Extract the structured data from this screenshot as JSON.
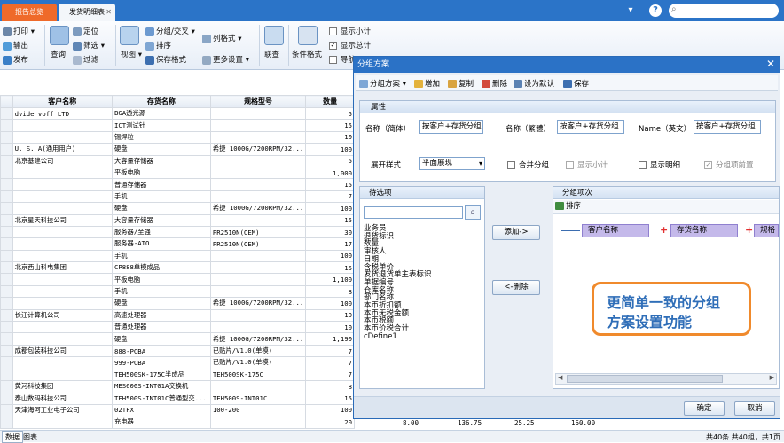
{
  "tabs": [
    {
      "label": "报告总览",
      "active": false
    },
    {
      "label": "发货明细表",
      "active": true
    }
  ],
  "ribbon": {
    "print": "打印",
    "export": "输出",
    "publish": "发布",
    "query": "查询",
    "locate": "定位",
    "filter": "筛选",
    "filter2": "过滤",
    "view": "视图",
    "group_cross": "分组/交叉",
    "sort": "排序",
    "save_format": "保存格式",
    "column_format": "列格式",
    "more_settings": "更多设置",
    "join_query": "联查",
    "condition_format": "条件格式",
    "show_subtotal": "显示小计",
    "show_total": "显示总计",
    "navigation": "导航"
  },
  "table": {
    "headers": [
      "客户名称",
      "存货名称",
      "规格型号",
      "数量"
    ],
    "rows": [
      [
        "dvide voff LTD",
        "BGA透光源",
        "",
        "5"
      ],
      [
        "",
        "ICT测试针",
        "",
        "15"
      ],
      [
        "",
        "锡焊粒",
        "",
        "10"
      ],
      [
        "U. S. A(通用用户)",
        "硬盘",
        "希捷 1000G/7200RPM/32...",
        "100"
      ],
      [
        "北京基建公司",
        "大容量存储器",
        "",
        "5"
      ],
      [
        "",
        "平板电脑",
        "",
        "1,000"
      ],
      [
        "",
        "普通存储器",
        "",
        "15"
      ],
      [
        "",
        "手机",
        "",
        "7"
      ],
      [
        "",
        "硬盘",
        "希捷 1000G/7200RPM/32...",
        "100"
      ],
      [
        "北京星天科技公司",
        "大容量存储器",
        "",
        "15"
      ],
      [
        "",
        "服务器/至强",
        "PR2510N(OEM)",
        "30"
      ],
      [
        "",
        "服务器-ATO",
        "PR2510N(OEM)",
        "17"
      ],
      [
        "",
        "手机",
        "",
        "100"
      ],
      [
        "北京西山科电集团",
        "CP888单模成品",
        "",
        "15"
      ],
      [
        "",
        "平板电脑",
        "",
        "1,100"
      ],
      [
        "",
        "手机",
        "",
        "8"
      ],
      [
        "",
        "硬盘",
        "希捷 1000G/7200RPM/32...",
        "100"
      ],
      [
        "长江计算机公司",
        "高速处理器",
        "",
        "10"
      ],
      [
        "",
        "普通处理器",
        "",
        "10"
      ],
      [
        "",
        "硬盘",
        "希捷 1000G/7200RPM/32...",
        "1,190"
      ],
      [
        "成都包装科技公司",
        "888-PCBA",
        "已贴片/V1.0(单模)",
        "7"
      ],
      [
        "",
        "999-PCBA",
        "已贴片/V1.0(单模)",
        "7"
      ],
      [
        "",
        "TEH500SK-175C半成品",
        "TEH500SK-175C",
        "7"
      ],
      [
        "黄河科技集团",
        "MES600S-INT01A交换机",
        "",
        "8"
      ],
      [
        "泰山数码科技公司",
        "TEH500S-INT01C普通型交...",
        "TEH500S-INT01C",
        "15"
      ],
      [
        "天津海河工业电子公司",
        "02TFX",
        "100-200",
        "100"
      ],
      [
        "",
        "充电器",
        "",
        "20"
      ]
    ]
  },
  "status": {
    "tab_data": "数据",
    "tab_chart": "图表",
    "summary": "共40条 共40组，共1页"
  },
  "underrow": {
    "v1": "8.00",
    "v2": "136.75",
    "v3": "25.25",
    "v4": "160.00"
  },
  "dialog": {
    "title": "分组方案",
    "toolbar": {
      "scheme": "分组方案",
      "add": "增加",
      "copy": "复制",
      "delete": "删除",
      "set_default": "设为默认",
      "save": "保存"
    },
    "attr_header": "属性",
    "name_cn_label": "名称（简体）",
    "name_cn_value": "按客户+存货分组",
    "name_tw_label": "名称（繁體）",
    "name_tw_value": "按客户+存货分组",
    "name_en_label": "Name（英文）",
    "name_en_value": "按客户+存货分组",
    "expand_label": "展开样式",
    "expand_value": "平面展现",
    "merge_group": "合并分组",
    "show_subtotal": "显示小计",
    "show_detail": "显示明细",
    "group_first": "分组项前置",
    "candidates_header": "待选项",
    "candidates": [
      "业务员",
      "退货标识",
      "数量",
      "审核人",
      "日期",
      "含税单价",
      "发货退货单主表标识",
      "单据编号",
      "仓库名称",
      "部门名称",
      "本币折扣额",
      "本币无税金额",
      "本币税额",
      "本币价税合计",
      "cDefine1"
    ],
    "add_btn": "添加->",
    "remove_btn": "<-删除",
    "group_header": "分组项次",
    "sort_label": "排序",
    "group_items": [
      "客户名称",
      "存货名称",
      "规格"
    ],
    "ok": "确定",
    "cancel": "取消"
  },
  "callout": {
    "line1": "更简单一致的分组",
    "line2": "方案设置功能"
  },
  "colors": {
    "titlebar": "#2b74c8",
    "active_tab": "#ef6a2a",
    "callout_border": "#f08a2c",
    "callout_text": "#2f6eb8",
    "group_node": "#c4b9ea"
  }
}
